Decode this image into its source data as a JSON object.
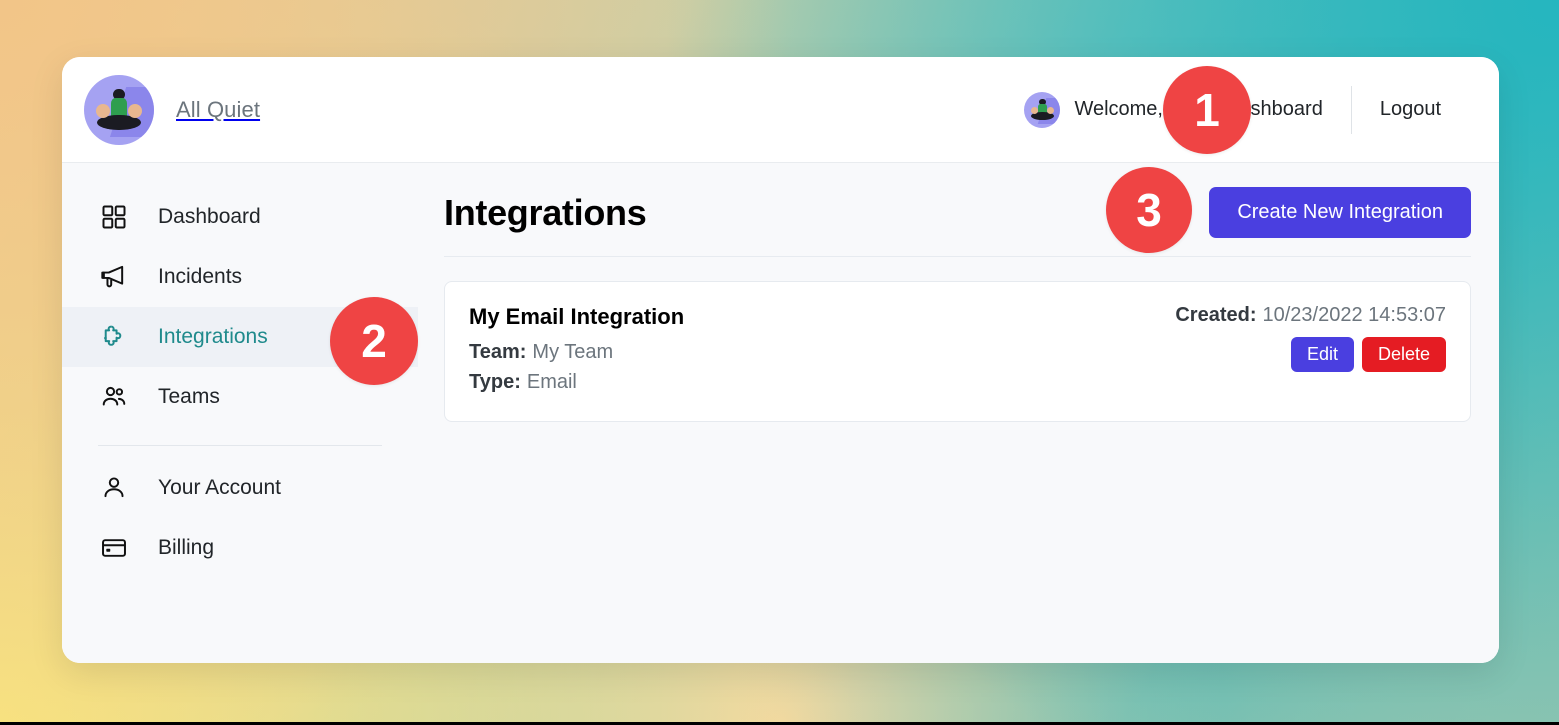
{
  "brand": {
    "name": "All Quiet",
    "logo_icon": "meditation-avatar-icon"
  },
  "navbar": {
    "welcome_text": "Welcome,",
    "avatar_icon": "meditation-avatar-icon",
    "dashboard_link": "Dashboard",
    "logout_link": "Logout"
  },
  "sidebar": {
    "primary_items": [
      {
        "label": "Dashboard",
        "icon": "grid-icon",
        "active": false
      },
      {
        "label": "Incidents",
        "icon": "megaphone-icon",
        "active": false
      },
      {
        "label": "Integrations",
        "icon": "puzzle-piece-icon",
        "active": true
      },
      {
        "label": "Teams",
        "icon": "people-icon",
        "active": false
      }
    ],
    "secondary_items": [
      {
        "label": "Your Account",
        "icon": "person-icon"
      },
      {
        "label": "Billing",
        "icon": "credit-card-icon"
      }
    ]
  },
  "content": {
    "page_title": "Integrations",
    "create_button": "Create New Integration"
  },
  "integrations": [
    {
      "name": "My Email Integration",
      "team_label": "Team:",
      "team_value": "My Team",
      "type_label": "Type:",
      "type_value": "Email",
      "created_label": "Created:",
      "created_value": "10/23/2022 14:53:07",
      "edit_button": "Edit",
      "delete_button": "Delete"
    }
  ],
  "annotations": [
    {
      "number": "1"
    },
    {
      "number": "2"
    },
    {
      "number": "3"
    }
  ],
  "colors": {
    "accent_primary": "#4a3fe0",
    "accent_danger": "#e51c23",
    "active_nav": "#1f8a8c",
    "badge": "#ef4444",
    "logo_bg": "#a5a2f2"
  }
}
